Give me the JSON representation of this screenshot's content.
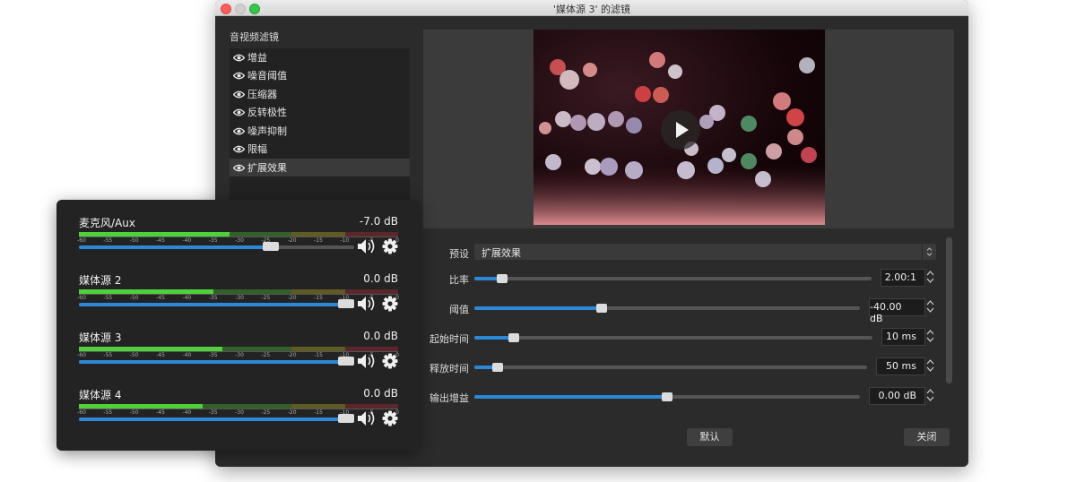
{
  "window": {
    "title": "'媒体源 3' 的滤镜"
  },
  "filters": {
    "section_label": "音视频滤镜",
    "items": [
      {
        "label": "增益"
      },
      {
        "label": "噪音阈值"
      },
      {
        "label": "压缩器"
      },
      {
        "label": "反转极性"
      },
      {
        "label": "噪声抑制"
      },
      {
        "label": "限幅"
      },
      {
        "label": "扩展效果",
        "selected": true
      }
    ]
  },
  "properties": {
    "preset": {
      "label": "预设",
      "value": "扩展效果"
    },
    "sliders": [
      {
        "label": "比率",
        "value_text": "2.00:1",
        "fraction": 0.07
      },
      {
        "label": "阈值",
        "value_text": "-40.00 dB",
        "fraction": 0.33
      },
      {
        "label": "起始时间",
        "value_text": "10 ms",
        "fraction": 0.1
      },
      {
        "label": "释放时间",
        "value_text": "50 ms",
        "fraction": 0.06
      },
      {
        "label": "输出增益",
        "value_text": "0.00 dB",
        "fraction": 0.5
      }
    ]
  },
  "buttons": {
    "defaults": "默认",
    "close": "关闭"
  },
  "mixer": {
    "tick_labels": [
      "-60",
      "-55",
      "-50",
      "-45",
      "-40",
      "-35",
      "-30",
      "-25",
      "-20",
      "-15",
      "-10",
      "-5",
      "0"
    ],
    "channels": [
      {
        "name": "麦克风/Aux",
        "db": "-7.0 dB",
        "volume": 0.71
      },
      {
        "name": "媒体源 2",
        "db": "0.0 dB",
        "volume": 1.0
      },
      {
        "name": "媒体源 3",
        "db": "0.0 dB",
        "volume": 1.0
      },
      {
        "name": "媒体源 4",
        "db": "0.0 dB",
        "volume": 1.0
      }
    ]
  },
  "colors": {
    "accent": "#2d88d8",
    "meter_green": "#4fd13a",
    "meter_yellow": "#d4c22a",
    "meter_red": "#c8323a"
  },
  "icons": {
    "visibility": "eye-icon",
    "volume": "speaker-icon",
    "settings": "gear-icon",
    "play": "play-icon"
  }
}
